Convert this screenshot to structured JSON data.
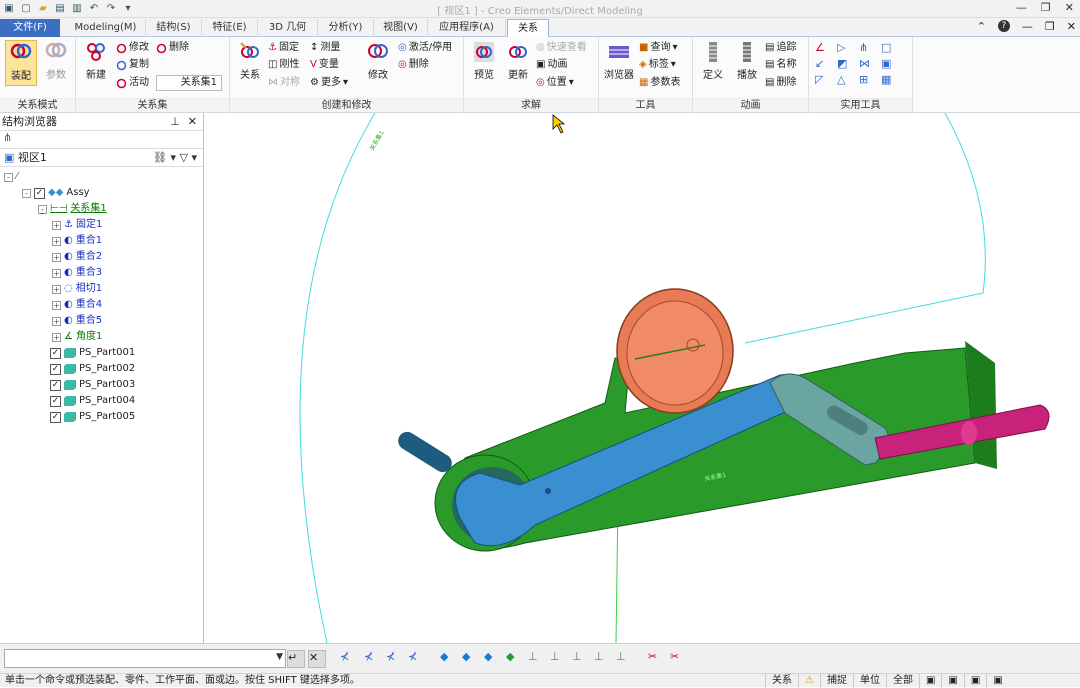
{
  "app": {
    "title": "[ 视区1 ] - Creo Elements/Direct Modeling"
  },
  "menu": {
    "tabs": [
      "文件(F)",
      "Modeling(M)",
      "结构(S)",
      "特征(E)",
      "3D 几何",
      "分析(Y)",
      "视图(V)",
      "应用程序(A)",
      "关系"
    ]
  },
  "ribbon": {
    "mode": {
      "label": "关系模式",
      "assemble": "装配",
      "params": "参数"
    },
    "sets": {
      "label": "关系集",
      "new": "新建",
      "modify": "修改",
      "delete": "删除",
      "copy": "复制",
      "active": "活动",
      "active_value": "关系集1"
    },
    "create": {
      "label": "创建和修改",
      "relation": "关系",
      "fix": "固定",
      "rigid": "刚性",
      "symmetric": "对称",
      "measure": "测量",
      "variable": "变量",
      "more": "更多",
      "modify": "修改",
      "activate": "激活/停用",
      "delete": "删除"
    },
    "solve": {
      "label": "求解",
      "preview": "预览",
      "update": "更新",
      "quick_check": "快速查看",
      "animate": "动画",
      "position": "位置"
    },
    "tools": {
      "label": "工具",
      "browser": "浏览器",
      "query": "查询",
      "tag": "标签",
      "param_table": "参数表"
    },
    "animation": {
      "label": "动画",
      "define": "定义",
      "play": "播放",
      "track": "追踪",
      "name": "名称",
      "delete": "删除"
    },
    "utilities": {
      "label": "实用工具"
    }
  },
  "browser": {
    "title": "结构浏览器",
    "view": "视区1",
    "assembly": "Assy",
    "relation_set": "关系集1",
    "relations": [
      "固定1",
      "重合1",
      "重合2",
      "重合3",
      "相切1",
      "重合4",
      "重合5",
      "角度1"
    ],
    "parts": [
      "PS_Part001",
      "PS_Part002",
      "PS_Part003",
      "PS_Part004",
      "PS_Part005"
    ]
  },
  "viewport": {
    "labels": [
      "关系集1",
      "关系集1"
    ]
  },
  "status": {
    "prompt": "单击一个命令或预选装配、零件、工作平面、面或边。按住 SHIFT 键选择多项。",
    "relations": "关系",
    "catch": "捕捉",
    "units": "单位",
    "filter": "全部"
  }
}
